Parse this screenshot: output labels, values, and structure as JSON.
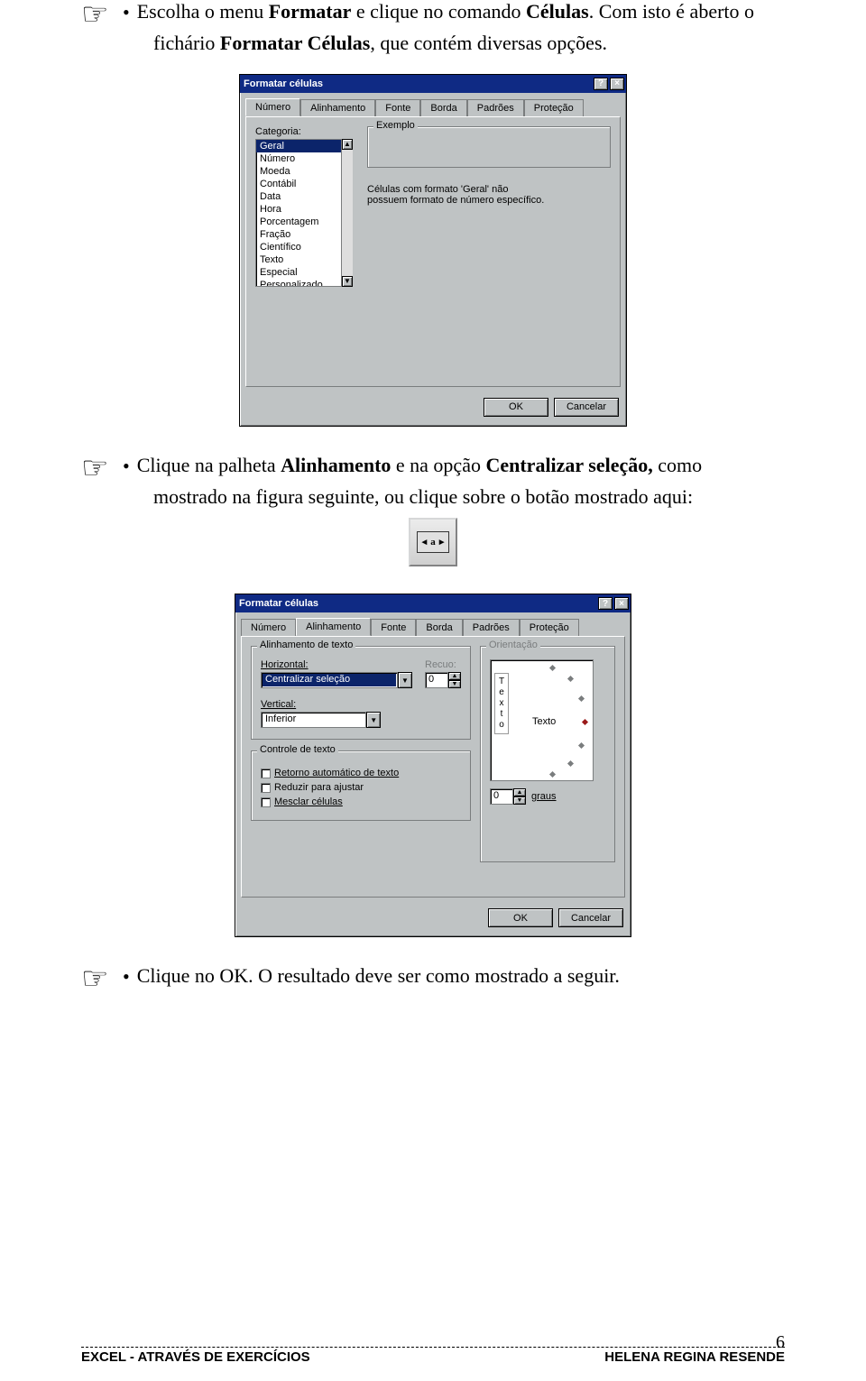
{
  "text": {
    "p1a": "Escolha o menu ",
    "p1b": "Formatar",
    "p1c": " e clique no comando ",
    "p1d": "Células",
    "p1e": ". Com isto é aberto o",
    "p1f": "fichário ",
    "p1g": "Formatar Células",
    "p1h": ", que contém diversas opções.",
    "p2a": "Clique  na  palheta    ",
    "p2b": "Alinhamento",
    "p2c": "  e  na  opção  ",
    "p2d": "Centralizar  seleção,",
    "p2e": "  como",
    "p2f": "mostrado na figura seguinte, ou clique sobre o botão mostrado aqui:",
    "p3": "Clique no OK. O resultado deve ser como mostrado a seguir."
  },
  "dialog1": {
    "title": "Formatar células",
    "help": "?",
    "close": "×",
    "tabs": [
      "Número",
      "Alinhamento",
      "Fonte",
      "Borda",
      "Padrões",
      "Proteção"
    ],
    "active_tab": 0,
    "category_label": "Categoria:",
    "example_label": "Exemplo",
    "categories": [
      "Geral",
      "Número",
      "Moeda",
      "Contábil",
      "Data",
      "Hora",
      "Porcentagem",
      "Fração",
      "Científico",
      "Texto",
      "Especial",
      "Personalizado"
    ],
    "selected_category": 0,
    "desc": "Células com formato 'Geral' não possuem formato de número específico.",
    "ok": "OK",
    "cancel": "Cancelar"
  },
  "dialog2": {
    "title": "Formatar células",
    "help": "?",
    "close": "×",
    "tabs": [
      "Número",
      "Alinhamento",
      "Fonte",
      "Borda",
      "Padrões",
      "Proteção"
    ],
    "active_tab": 1,
    "group_align": "Alinhamento de texto",
    "group_orient": "Orientação",
    "horizontal_label": "Horizontal:",
    "horizontal_value": "Centralizar seleção",
    "recuo_label": "Recuo:",
    "recuo_value": "0",
    "vertical_label": "Vertical:",
    "vertical_value": "Inferior",
    "group_ctrl": "Controle de texto",
    "chk_wrap": "Retorno automático de texto",
    "chk_shrink": "Reduzir para ajustar",
    "chk_merge": "Mesclar células",
    "orient_vertical": [
      "T",
      "e",
      "x",
      "t",
      "o"
    ],
    "orient_word": "Texto",
    "degrees_value": "0",
    "degrees_label": "graus",
    "ok": "OK",
    "cancel": "Cancelar"
  },
  "footer": {
    "left": "EXCEL - ATRAVÉS DE EXERCÍCIOS",
    "right": "HELENA REGINA RESENDE",
    "page": "6"
  },
  "glyphs": {
    "hand": "☞",
    "bullet": "•",
    "up": "▲",
    "down": "▼"
  }
}
